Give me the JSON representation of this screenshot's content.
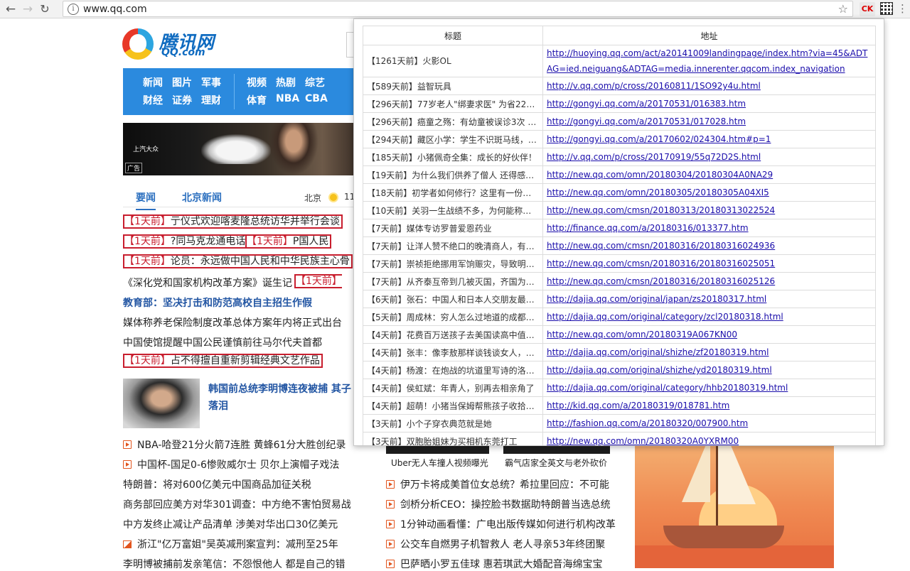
{
  "browser": {
    "url": "www.qq.com",
    "ext_ck_label": "CK"
  },
  "logo": {
    "cn": "腾讯网",
    "en": "QQ.com"
  },
  "navbar": {
    "row1": [
      "新闻",
      "图片",
      "军事",
      "视频",
      "热剧",
      "综艺"
    ],
    "row2": [
      "财经",
      "证券",
      "理财",
      "体育",
      "NBA",
      "CBA"
    ]
  },
  "banner": {
    "brand": "上汽大众",
    "ad_label": "广告"
  },
  "tabs": [
    "要闻",
    "北京新闻"
  ],
  "weather": {
    "city": "北京",
    "temp": "11°"
  },
  "news": [
    {
      "tag": "【1天前】",
      "text": "亍仪式欢迎喀麦隆总统访华并举行会谈"
    },
    {
      "tag": "【1天前】",
      "text": "?同马克龙通电话",
      "tag2": "【1天前】",
      "text2": "P国人民"
    },
    {
      "tag": "【1天前】",
      "text": "论员：永远做中国人民和中华民族主心骨"
    },
    {
      "text": "《深化党和国家机构改革方案》诞生记",
      "tag": "【1天前】"
    },
    {
      "text": "教育部：坚决打击和防范高校自主招生作假"
    },
    {
      "text": "媒体称养老保险制度改革总体方案年内将正式出台"
    },
    {
      "text": "中国使馆提醒中国公民谨慎前往马尔代夫首都"
    },
    {
      "tag": "【1天前】",
      "text": "占不得擅自重新剪辑经典文艺作品"
    }
  ],
  "feature": {
    "text": "韩国前总统李明博连夜被捕 其子落泪"
  },
  "list_left": [
    {
      "icon": "video",
      "text": "NBA-哈登21分火箭7连胜 黄蜂61分大胜创纪录"
    },
    {
      "icon": "video",
      "text": "中国杯-国足0-6惨败威尔士 贝尔上演帽子戏法"
    },
    {
      "icon": "",
      "text": "特朗普：将对600亿美元中国商品加征关税"
    },
    {
      "icon": "",
      "text": "商务部回应美方对华301调查：中方绝不害怕贸易战"
    },
    {
      "icon": "",
      "text": "中方发终止减让产品清单 涉美对华出口30亿美元"
    },
    {
      "icon": "photo",
      "text": "浙江\"亿万富姐\"吴英减刑案宣判：减刑至25年"
    },
    {
      "icon": "",
      "text": "李明博被捕前发亲笔信：不怨恨他人 都是自己的错"
    }
  ],
  "video_captions": [
    "Uber无人车撞人视频曝光",
    "霸气店家全英文与老外砍价"
  ],
  "list_mid": [
    {
      "icon": "video",
      "text": "伊万卡将成美首位女总统？希拉里回应：不可能"
    },
    {
      "icon": "video",
      "text": "剑桥分析CEO：操控脸书数据助特朗普当选总统"
    },
    {
      "icon": "video",
      "text": "1分钟动画看懂：广电出版传媒如何进行机构改革"
    },
    {
      "icon": "video",
      "text": "公交车自燃男子机智救人 老人寻亲53年终团聚"
    },
    {
      "icon": "video",
      "text": "巴萨晒小罗五佳球 惠若琪武大婚配音海绵宝宝"
    }
  ],
  "popup": {
    "headers": [
      "标题",
      "地址"
    ],
    "rows": [
      {
        "title": "【1261天前】火影OL",
        "url": "http://huoying.qq.com/act/a20141009landingpage/index.htm?via=45&ADTAG=ied.neiguang&ADTAG=media.innerenter.qqcom.index_navigation"
      },
      {
        "title": "【589天前】益智玩具",
        "url": "http://v.qq.com/p/cross/20160811/1SO92y4u.html"
      },
      {
        "title": "【296天前】77岁老人\"绑妻求医\" 为省22元…",
        "url": "http://gongyi.qq.com/a/20170531/016383.htm"
      },
      {
        "title": "【296天前】癌童之殇：有幼童被误诊3次 异…",
        "url": "http://gongyi.qq.com/a/20170531/017028.htm"
      },
      {
        "title": "【294天前】藏区小学：学生不识斑马线，老…",
        "url": "http://gongyi.qq.com/a/20170602/024304.htm#p=1"
      },
      {
        "title": "【185天前】小猪佩奇全集：成长的好伙伴！",
        "url": "http://v.qq.com/p/cross/20170919/55q72D2S.html"
      },
      {
        "title": "【19天前】为什么我们供养了僧人 还得感谢…",
        "url": "http://new.qq.com/omn/20180304/20180304A0NA29"
      },
      {
        "title": "【18天前】初学者如何修行？这里有一份最…",
        "url": "http://new.qq.com/omn/20180305/20180305A04XI5"
      },
      {
        "title": "【10天前】关羽一生战绩不多，为何能称…",
        "url": "http://new.qq.com/cmsn/20180313/20180313022524"
      },
      {
        "title": "【7天前】媒体专访罗普爱恩药业",
        "url": "http://finance.qq.com/a/20180316/013377.htm"
      },
      {
        "title": "【7天前】让洋人赞不绝口的晚清商人，有着…",
        "url": "http://new.qq.com/cmsn/20180316/20180316024936"
      },
      {
        "title": "【7天前】崇祯拒绝挪用军饷赈灾，导致明朝…",
        "url": "http://new.qq.com/cmsn/20180316/20180316025051"
      },
      {
        "title": "【7天前】从齐泰互帝到几被灭国，齐国为何…",
        "url": "http://new.qq.com/cmsn/20180316/20180316025126"
      },
      {
        "title": "【6天前】张石：中国人和日本人交朋友最忌…",
        "url": "http://dajia.qq.com/original/japan/zs20180317.html"
      },
      {
        "title": "【5天前】周成林：穷人怎么过地道的成都生活",
        "url": "http://dajia.qq.com/original/category/zcl20180318.html"
      },
      {
        "title": "【4天前】花费百万送孩子去美国读高中值不…",
        "url": "http://new.qq.com/omn/20180319A067KN00"
      },
      {
        "title": "【4天前】张丰：像李敖那样谈钱谈女人，大…",
        "url": "http://dajia.qq.com/original/shizhe/zf20180319.html"
      },
      {
        "title": "【4天前】杨渡：在炮战的坑道里写诗的洛夫…",
        "url": "http://dajia.qq.com/original/shizhe/yd20180319.html"
      },
      {
        "title": "【4天前】侯虹斌：年青人，别再去相亲角了",
        "url": "http://dajia.qq.com/original/category/hhb20180319.html"
      },
      {
        "title": "【4天前】超萌！小猪当保姆帮熊孩子收拾玩具",
        "url": "http://kid.qq.com/a/20180319/018781.htm"
      },
      {
        "title": "【3天前】小个子穿衣典范就是她",
        "url": "http://fashion.qq.com/a/20180320/007900.htm"
      },
      {
        "title": "【3天前】双胞胎姐妹为买相机东莞打工",
        "url": "http://new.qq.com/omn/20180320A0YXRM00"
      }
    ]
  }
}
